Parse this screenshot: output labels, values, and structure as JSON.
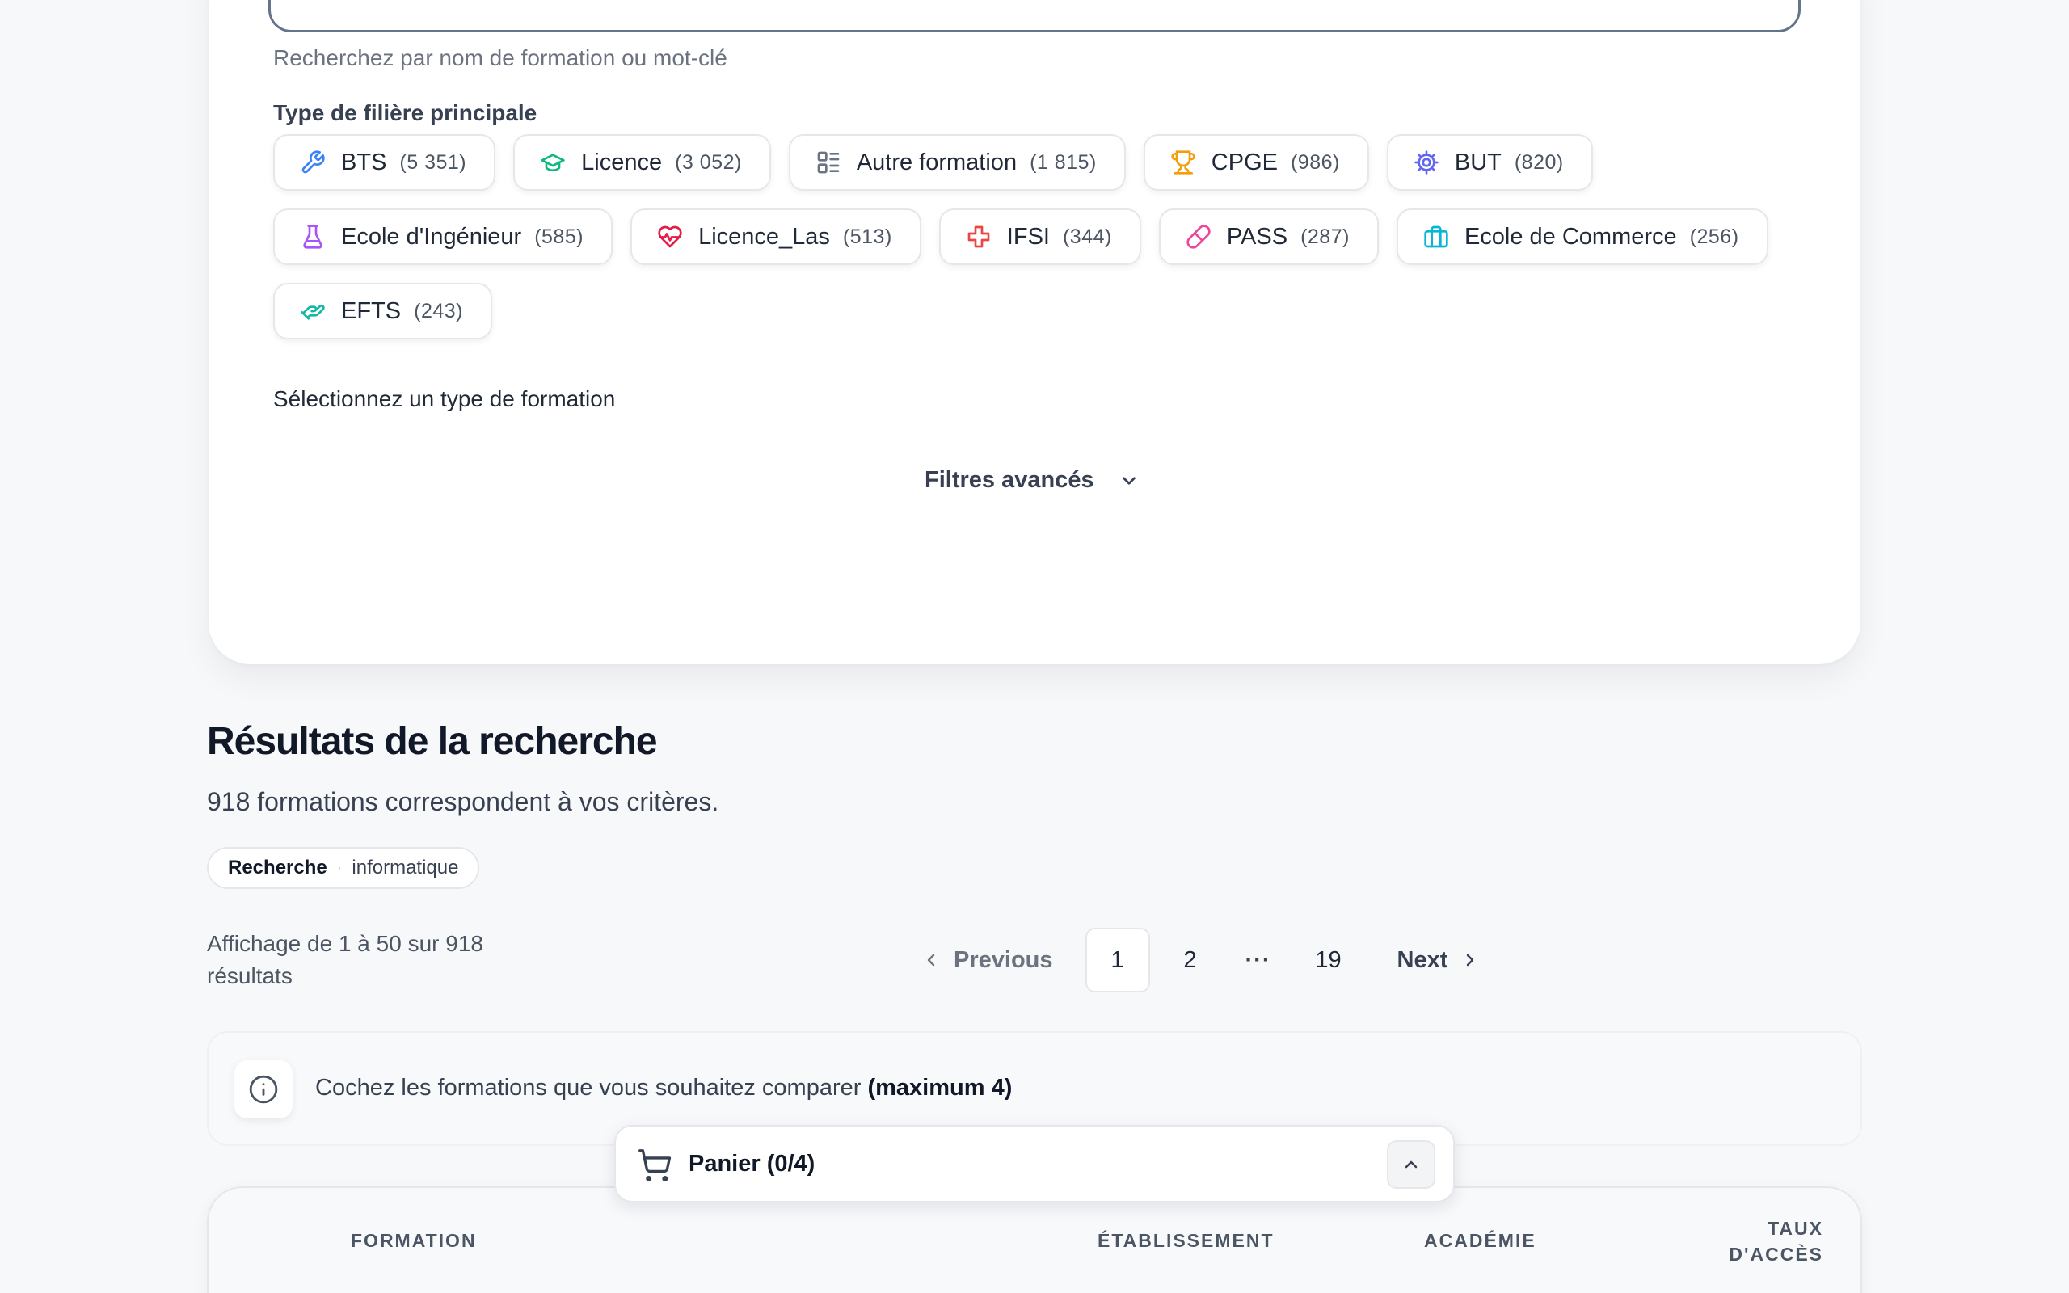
{
  "search": {
    "help_text": "Recherchez par nom de formation ou mot-clé"
  },
  "filiere": {
    "label": "Type de filière principale",
    "chips": [
      {
        "label": "BTS",
        "count": "(5 351)",
        "icon": "wrench-icon",
        "color": "#3b82f6"
      },
      {
        "label": "Licence",
        "count": "(3 052)",
        "icon": "graduation-cap-icon",
        "color": "#10b981"
      },
      {
        "label": "Autre formation",
        "count": "(1 815)",
        "icon": "list-icon",
        "color": "#6b7280"
      },
      {
        "label": "CPGE",
        "count": "(986)",
        "icon": "trophy-icon",
        "color": "#f59e0b"
      },
      {
        "label": "BUT",
        "count": "(820)",
        "icon": "gear-icon",
        "color": "#6366f1"
      },
      {
        "label": "Ecole d'Ingénieur",
        "count": "(585)",
        "icon": "flask-icon",
        "color": "#a855f7"
      },
      {
        "label": "Licence_Las",
        "count": "(513)",
        "icon": "heart-pulse-icon",
        "color": "#e11d48"
      },
      {
        "label": "IFSI",
        "count": "(344)",
        "icon": "medical-cross-icon",
        "color": "#ef4444"
      },
      {
        "label": "PASS",
        "count": "(287)",
        "icon": "pill-icon",
        "color": "#ec4899"
      },
      {
        "label": "Ecole de Commerce",
        "count": "(256)",
        "icon": "briefcase-icon",
        "color": "#06b6d4"
      },
      {
        "label": "EFTS",
        "count": "(243)",
        "icon": "helping-hand-icon",
        "color": "#14b8a6"
      }
    ],
    "select_help": "Sélectionnez un type de formation"
  },
  "advanced_filters": {
    "label": "Filtres avancés"
  },
  "results": {
    "title": "Résultats de la recherche",
    "count_text": "918 formations correspondent à vos critères.",
    "tag": {
      "key": "Recherche",
      "value": "informatique"
    },
    "showing_text": "Affichage de 1 à 50 sur 918 résultats"
  },
  "pagination": {
    "previous": "Previous",
    "next": "Next",
    "current": "1",
    "page2": "2",
    "ellipsis": "···",
    "last": "19"
  },
  "compare": {
    "text": "Cochez les formations que vous souhaitez comparer",
    "emphasis": "(maximum 4)"
  },
  "cart": {
    "label": "Panier (0/4)"
  },
  "table": {
    "headers": {
      "formation": "FORMATION",
      "etablissement": "ÉTABLISSEMENT",
      "academie": "ACADÉMIE",
      "taux_line1": "TAUX",
      "taux_line2": "D'ACCÈS"
    }
  }
}
